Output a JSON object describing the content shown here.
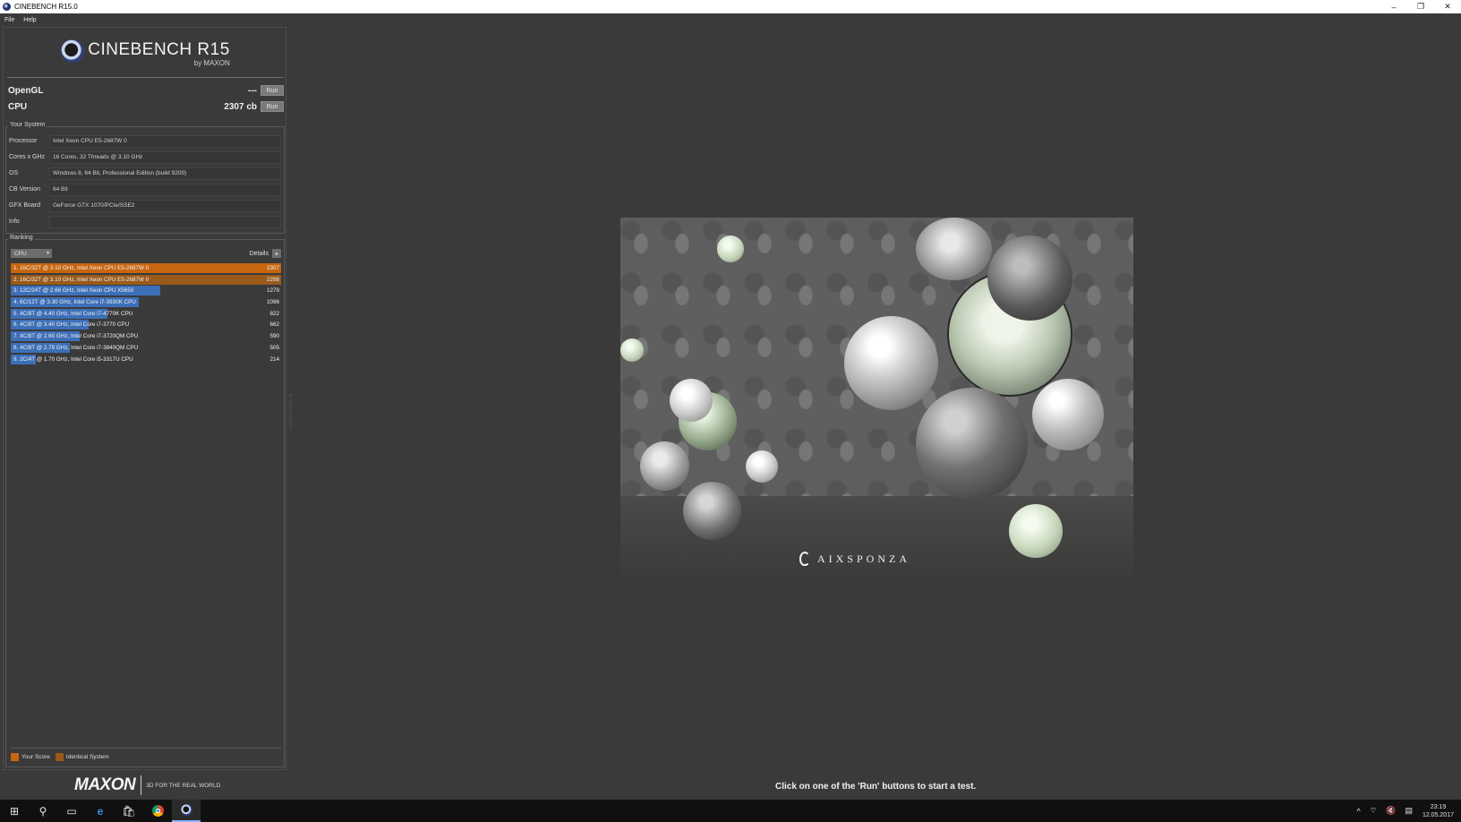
{
  "window": {
    "title": "CINEBENCH R15.0",
    "controls": [
      "–",
      "❐",
      "✕"
    ]
  },
  "menu": {
    "file": "File",
    "help": "Help"
  },
  "logo": {
    "name": "CINEBENCH R15",
    "sub": "by MAXON"
  },
  "benchmarks": {
    "opengl": {
      "label": "OpenGL",
      "score": "---",
      "run": "Run"
    },
    "cpu": {
      "label": "CPU",
      "score": "2307 cb",
      "run": "Run"
    }
  },
  "your_system": {
    "title": "Your System",
    "rows": [
      {
        "key": "Processor",
        "value": "Intel Xeon CPU E5-2687W 0"
      },
      {
        "key": "Cores x GHz",
        "value": "16 Cores, 32 Threads @ 3.10 GHz"
      },
      {
        "key": "OS",
        "value": "Windows 8, 64 Bit, Professional Edition (build 9200)"
      },
      {
        "key": "CB Version",
        "value": "64 Bit"
      },
      {
        "key": "GFX Board",
        "value": "GeForce GTX 1070/PCIe/SSE2"
      },
      {
        "key": "Info",
        "value": ""
      }
    ]
  },
  "ranking": {
    "title": "Ranking",
    "dropdown": "CPU",
    "details": "Details",
    "max_score": 2307,
    "items": [
      {
        "label": "1. 16C/32T @ 3.10 GHz,  Intel Xeon CPU E5-2687W 0",
        "score": "2307",
        "value": 2307,
        "kind": "yours"
      },
      {
        "label": "2. 16C/32T @ 3.10 GHz,  Intel Xeon CPU E5-2687W 0",
        "score": "2298",
        "value": 2298,
        "kind": "identical"
      },
      {
        "label": "3. 12C/24T @ 2.66 GHz, Intel Xeon CPU X5650",
        "score": "1279",
        "value": 1279,
        "kind": "other"
      },
      {
        "label": "4. 6C/12T @ 3.30 GHz,  Intel Core i7-3930K CPU",
        "score": "1096",
        "value": 1096,
        "kind": "other"
      },
      {
        "label": "5. 4C/8T @ 4.40 GHz, Intel Core i7-4770K CPU",
        "score": "822",
        "value": 822,
        "kind": "other"
      },
      {
        "label": "6. 4C/8T @ 3.40 GHz,  Intel Core i7-3770 CPU",
        "score": "662",
        "value": 662,
        "kind": "other"
      },
      {
        "label": "7. 4C/8T @ 2.60 GHz, Intel Core i7-3720QM CPU",
        "score": "590",
        "value": 590,
        "kind": "other"
      },
      {
        "label": "8. 4C/8T @ 2.79 GHz,  Intel Core i7-3840QM CPU",
        "score": "505",
        "value": 505,
        "kind": "other"
      },
      {
        "label": "9. 2C/4T @ 1.70 GHz,  Intel Core i5-3317U CPU",
        "score": "214",
        "value": 214,
        "kind": "other"
      }
    ]
  },
  "legend": {
    "yours": "Your Score",
    "identical": "Identical System"
  },
  "colors": {
    "yours": "#c8650f",
    "identical": "#9a5a1c",
    "other": "#3d6fb8"
  },
  "footer": {
    "brand": "MAXON",
    "tagline": "3D FOR THE REAL WORLD"
  },
  "render": {
    "brand": "AIXSPONZA"
  },
  "status_message": "Click on one of the 'Run' buttons to start a test.",
  "taskbar": {
    "icons": [
      "windows-start-icon",
      "search-icon",
      "task-view-icon",
      "edge-icon",
      "store-icon",
      "chrome-icon",
      "cinebench-icon"
    ],
    "time": "23:19",
    "date": "12.05.2017"
  }
}
